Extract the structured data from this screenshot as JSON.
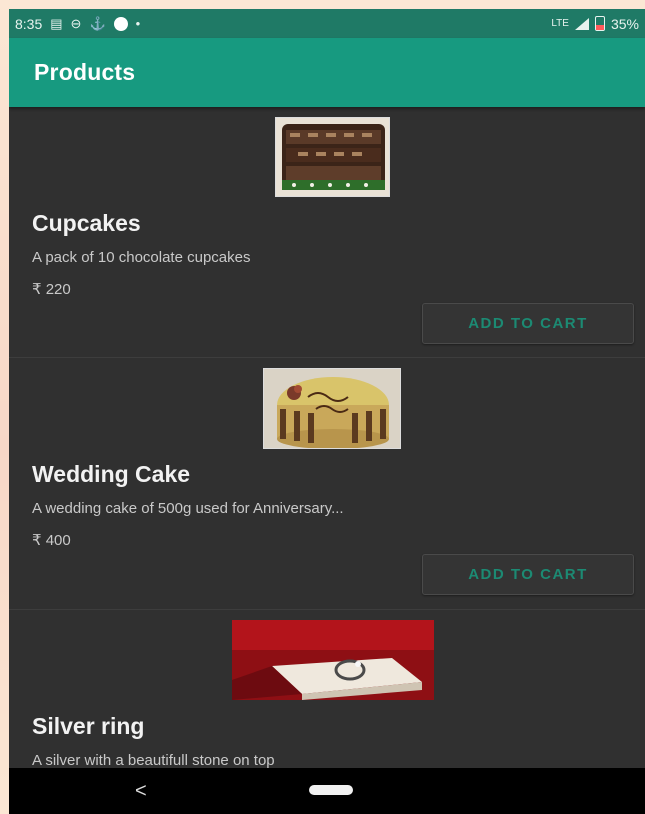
{
  "status_bar": {
    "time": "8:35",
    "network": "LTE",
    "battery": "35%"
  },
  "app_bar": {
    "title": "Products"
  },
  "products": [
    {
      "title": "Cupcakes",
      "description": "A pack of 10 chocolate cupcakes",
      "price": "₹ 220",
      "button": "ADD TO CART"
    },
    {
      "title": "Wedding Cake",
      "description": "A wedding cake of 500g used for Anniversary...",
      "price": "₹ 400",
      "button": "ADD TO CART"
    },
    {
      "title": "Silver ring",
      "description": "A silver with a beautifull stone on top"
    }
  ],
  "nav_bar": {
    "back_glyph": "<"
  },
  "colors": {
    "status_bar": "#1f7a66",
    "app_bar": "#179a80",
    "background": "#303030",
    "accent": "#1c8a73"
  }
}
